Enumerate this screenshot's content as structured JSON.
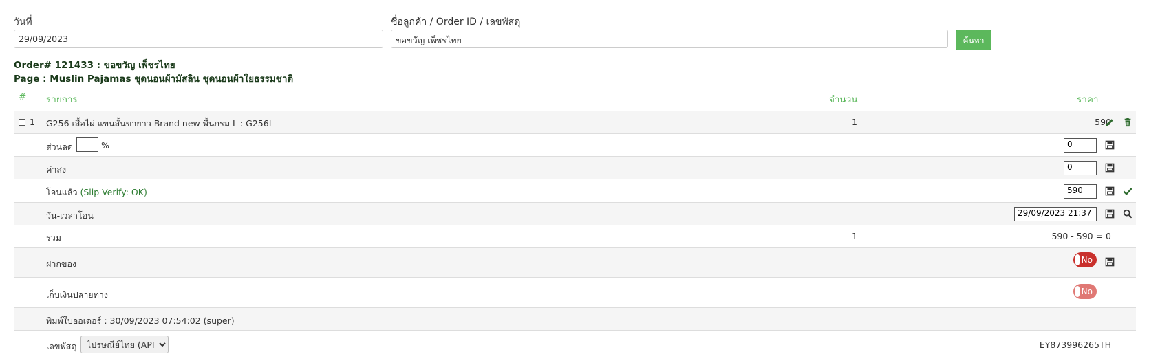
{
  "filters": {
    "date_label": "วันที่",
    "date_value": "29/09/2023",
    "customer_label": "ชื่อลูกค้า / Order ID / เลขพัสดุ",
    "customer_value": "ขอขวัญ เพ็ชรไทย",
    "search_button": "ค้นหา"
  },
  "order": {
    "title": "Order# 121433 : ขอขวัญ เพ็ชรไทย",
    "page": "Page : Muslin Pajamas ชุดนอนผ้ามัสลิน ชุดนอนผ้าใยธรรมชาติ"
  },
  "table": {
    "headers": {
      "num": "#",
      "item": "รายการ",
      "qty": "จำนวน",
      "price": "ราคา"
    },
    "item": {
      "index": "1",
      "name": "G256 เสื้อไผ่ แขนสั้นขายาว Brand new พื้นกรม L : G256L",
      "qty": "1",
      "price": "590"
    },
    "discount": {
      "label": "ส่วนลด",
      "percent_sign": "%",
      "percent_value": "",
      "value": "0"
    },
    "shipping": {
      "label": "ค่าส่ง",
      "value": "0"
    },
    "transferred": {
      "label": "โอนแล้ว",
      "verify": "(Slip Verify: OK)",
      "value": "590"
    },
    "transfer_time": {
      "label": "วัน-เวลาโอน",
      "value": "29/09/2023 21:37"
    },
    "total": {
      "label": "รวม",
      "qty": "1",
      "value": "590 - 590 = 0"
    },
    "deposit": {
      "label": "ฝากของ",
      "toggle": "No"
    },
    "cod": {
      "label": "เก็บเงินปลายทาง",
      "toggle": "No"
    },
    "printed": {
      "label": "พิมพ์ใบออเดอร์ : 30/09/2023 07:54:02 (super)"
    },
    "tracking": {
      "label": "เลขพัสดุ",
      "carrier": "ไปรษณีย์ไทย (API)",
      "number": "EY873996265TH"
    }
  },
  "colors": {
    "accent_green": "#5cb85c",
    "toggle_red": "#c9302c",
    "toggle_red_light": "#e07874"
  }
}
